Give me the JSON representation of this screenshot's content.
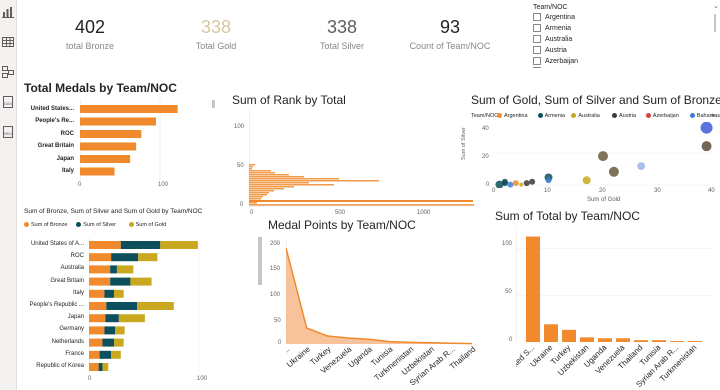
{
  "kpis": [
    {
      "value": "402",
      "label": "total Bronze",
      "color": "#252423"
    },
    {
      "value": "338",
      "label": "Total Gold",
      "color": "#d9c79c"
    },
    {
      "value": "338",
      "label": "Total Silver",
      "color": "#605e5c"
    },
    {
      "value": "93",
      "label": "Count of Team/NOC",
      "color": "#252423"
    }
  ],
  "slicer": {
    "title": "Team/NOC",
    "items": [
      "Argentina",
      "Armenia",
      "Australia",
      "Austria",
      "Azerbaijan"
    ]
  },
  "colors": {
    "orange": "#f08a2c",
    "teal": "#0d4f5c",
    "gold": "#c9a820",
    "light_orange": "#f7b98a"
  },
  "icons": [
    "bar-chart-icon",
    "table-icon",
    "model-icon",
    "dax-icon",
    "tmdl-icon"
  ],
  "rail_labels": {
    "dax": "DAX",
    "tmdl": "TMDL"
  },
  "total_medals": {
    "title": "Total Medals by Team/NOC",
    "chart_data": {
      "type": "bar",
      "categories": [
        "United States...",
        "People's Re...",
        "ROC",
        "Great Britain",
        "Japan",
        "Italy"
      ],
      "values": [
        113,
        88,
        71,
        65,
        58,
        40
      ],
      "xticks": [
        "0",
        "100"
      ],
      "xlim": [
        0,
        125
      ]
    }
  },
  "sum_rank": {
    "title": "Sum of Rank by Total",
    "chart_data": {
      "type": "bar",
      "yticks": [
        "100",
        "50",
        "0"
      ],
      "xticks": [
        "0",
        "500",
        "1000"
      ]
    }
  },
  "scatter": {
    "title": "Sum of Gold, Sum of Silver and Sum of Bronze by...",
    "legend_label": "Team/NOC",
    "legend": [
      {
        "name": "Argentina",
        "color": "#f08a2c"
      },
      {
        "name": "Armenia",
        "color": "#0d4f5c"
      },
      {
        "name": "Australia",
        "color": "#c9a820"
      },
      {
        "name": "Austria",
        "color": "#3a3a3a"
      },
      {
        "name": "Azerbaijan",
        "color": "#d64545"
      },
      {
        "name": "Bahamas",
        "color": "#3e7cd6"
      }
    ],
    "chart_data": {
      "type": "scatter",
      "xlabel": "Sum of Gold",
      "ylabel": "Sum of Silver",
      "xticks": [
        "0",
        "10",
        "20",
        "30",
        "40"
      ],
      "yticks": [
        "40",
        "20",
        "0"
      ],
      "xlim": [
        0,
        40
      ],
      "ylim": [
        0,
        45
      ],
      "points": [
        {
          "x": 1,
          "y": 1,
          "r": 4,
          "c": "#0d4f5c"
        },
        {
          "x": 2,
          "y": 2,
          "r": 3,
          "c": "#0d4f5c"
        },
        {
          "x": 3,
          "y": 1,
          "r": 3,
          "c": "#3e7cd6"
        },
        {
          "x": 4,
          "y": 2,
          "r": 3,
          "c": "#f08a2c"
        },
        {
          "x": 5,
          "y": 1,
          "r": 2,
          "c": "#c9a820"
        },
        {
          "x": 6,
          "y": 2,
          "r": 3,
          "c": "#3a3a3a"
        },
        {
          "x": 7,
          "y": 3,
          "r": 3,
          "c": "#3a3a3a"
        },
        {
          "x": 2,
          "y": 3,
          "r": 3,
          "c": "#0d4f5c"
        },
        {
          "x": 10,
          "y": 6,
          "r": 4,
          "c": "#0d4f5c"
        },
        {
          "x": 10,
          "y": 4,
          "r": 3,
          "c": "#3e7cd6"
        },
        {
          "x": 17,
          "y": 4,
          "r": 4,
          "c": "#c9a820"
        },
        {
          "x": 20,
          "y": 21,
          "r": 5,
          "c": "#6b5a3a"
        },
        {
          "x": 22,
          "y": 10,
          "r": 5,
          "c": "#6b5a3a"
        },
        {
          "x": 27,
          "y": 14,
          "r": 4,
          "c": "#9db4e8"
        },
        {
          "x": 39,
          "y": 28,
          "r": 5,
          "c": "#5a4a3a"
        },
        {
          "x": 39,
          "y": 41,
          "r": 6,
          "c": "#3e5ad6"
        }
      ]
    }
  },
  "stacked": {
    "title": "Sum of Bronze, Sum of Silver and Sum of Gold by Team/NOC",
    "legend": [
      {
        "name": "Sum of Bronze",
        "color": "#f08a2c"
      },
      {
        "name": "Sum of Silver",
        "color": "#0d4f5c"
      },
      {
        "name": "Sum of Gold",
        "color": "#c9a820"
      }
    ],
    "chart_data": {
      "type": "bar",
      "categories": [
        "United States of A...",
        "ROC",
        "Australia",
        "Great Britain",
        "Italy",
        "People's Republic ...",
        "Japan",
        "Germany",
        "Netherlands",
        "France",
        "Republic of Korea"
      ],
      "series": [
        {
          "name": "Sum of Bronze",
          "values": [
            33,
            23,
            22,
            22,
            16,
            18,
            17,
            16,
            14,
            11,
            10
          ]
        },
        {
          "name": "Sum of Silver",
          "values": [
            41,
            28,
            7,
            21,
            10,
            32,
            14,
            11,
            12,
            12,
            4
          ]
        },
        {
          "name": "Sum of Gold",
          "values": [
            39,
            20,
            17,
            22,
            10,
            38,
            27,
            10,
            10,
            10,
            6
          ]
        }
      ],
      "xticks": [
        "0",
        "100"
      ],
      "xlim": [
        0,
        125
      ]
    }
  },
  "medal_points": {
    "title": "Medal Points by Team/NOC",
    "chart_data": {
      "type": "area",
      "categories": [
        "Unite...",
        "Ukraine",
        "Turkey",
        "Venezuela",
        "Uganda",
        "Tunisia",
        "Turkmenistan",
        "Uzbekistan",
        "Syrian Arab R...",
        "Thailand"
      ],
      "values": [
        240,
        40,
        20,
        15,
        12,
        6,
        4,
        3,
        2,
        1
      ],
      "yticks": [
        "200",
        "150",
        "100",
        "50",
        "0"
      ],
      "ylim": [
        0,
        260
      ]
    }
  },
  "sum_total": {
    "title": "Sum of Total by Team/NOC",
    "chart_data": {
      "type": "bar",
      "categories": [
        "United S...",
        "Ukraine",
        "Turkey",
        "Uzbekistan",
        "Uganda",
        "Venezuela",
        "Thailand",
        "Tunisia",
        "Syrian Arab R...",
        "Turkmenistan"
      ],
      "values": [
        113,
        19,
        13,
        5,
        4,
        4,
        2,
        2,
        1,
        1
      ],
      "yticks": [
        "100",
        "50",
        "0"
      ],
      "ylim": [
        0,
        120
      ]
    }
  }
}
